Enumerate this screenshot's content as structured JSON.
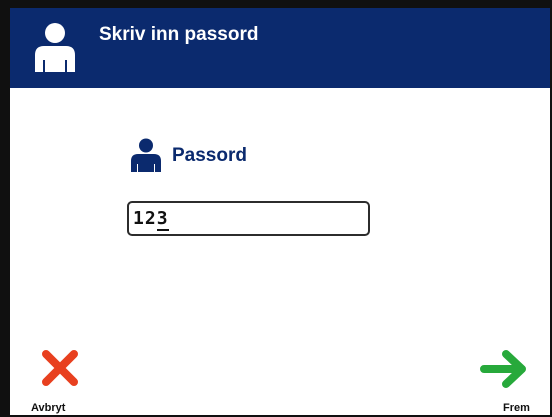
{
  "header": {
    "title": "Skriv inn passord",
    "icon": "user-icon",
    "background_color": "#0b2a6e"
  },
  "form": {
    "field_label": "Passord",
    "field_icon": "user-icon",
    "value_before_caret": "12",
    "value_at_caret": "3"
  },
  "footer": {
    "cancel_label": "Avbryt",
    "cancel_icon": "x-icon",
    "cancel_color": "#e8401f",
    "next_label": "Frem",
    "next_icon": "arrow-right-icon",
    "next_color": "#27a93b"
  }
}
